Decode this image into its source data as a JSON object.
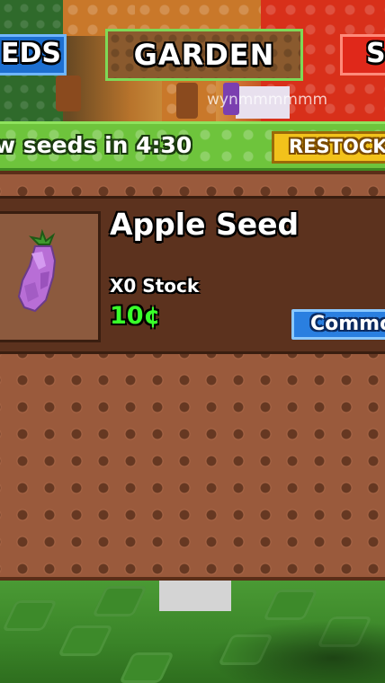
{
  "tabs": {
    "left": "EDS",
    "center": "GARDEN",
    "right": "S"
  },
  "player": {
    "username": "wynmmmmmm"
  },
  "restock": {
    "timer_text": "w seeds in 4:30",
    "button_label": "RESTOCK"
  },
  "shop": {
    "items": [
      {
        "name": "Apple Seed",
        "stock": "X0 Stock",
        "price": "10¢",
        "rarity": "Commo",
        "icon": "eggplant-seed-icon"
      }
    ]
  },
  "colors": {
    "accent_green": "#6ec43c",
    "price_green": "#39ff2a",
    "restock_yellow": "#f2c21b",
    "rarity_blue": "#2a7fe0",
    "panel_brown": "#9a5a3c"
  }
}
